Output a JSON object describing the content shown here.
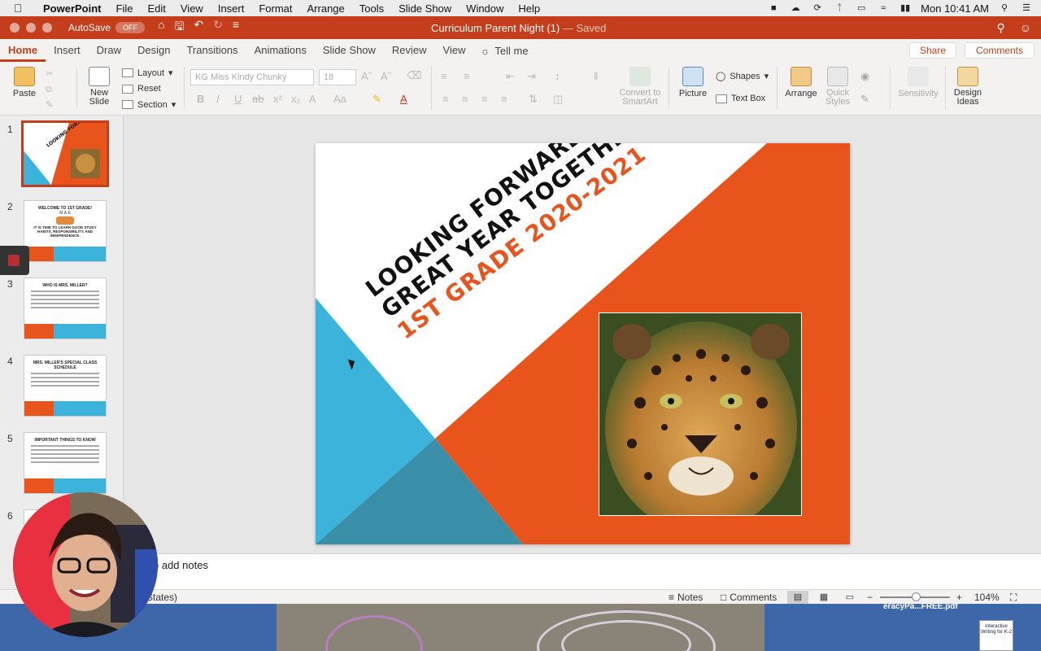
{
  "menubar": {
    "app_name": "PowerPoint",
    "items": [
      "File",
      "Edit",
      "View",
      "Insert",
      "Format",
      "Arrange",
      "Tools",
      "Slide Show",
      "Window",
      "Help"
    ],
    "clock": "Mon 10:41 AM"
  },
  "titlebar": {
    "autosave_label": "AutoSave",
    "autosave_state": "OFF",
    "doc_name": "Curriculum Parent Night (1)",
    "save_status": "— Saved"
  },
  "ribbon": {
    "tabs": [
      "Home",
      "Insert",
      "Draw",
      "Design",
      "Transitions",
      "Animations",
      "Slide Show",
      "Review",
      "View"
    ],
    "tell_me": "Tell me",
    "share": "Share",
    "comments": "Comments",
    "paste": "Paste",
    "new_slide": "New Slide",
    "layout": "Layout",
    "reset": "Reset",
    "section": "Section",
    "font_name": "KG Miss Kindy Chunky",
    "font_size": "18",
    "convert_smartart": "Convert to SmartArt",
    "picture": "Picture",
    "shapes": "Shapes",
    "text_box": "Text Box",
    "arrange": "Arrange",
    "quick_styles": "Quick Styles",
    "sensitivity": "Sensitivity",
    "design_ideas": "Design Ideas"
  },
  "thumbnails": {
    "numbers": [
      "1",
      "2",
      "3",
      "4",
      "5",
      "6"
    ],
    "slide2_title": "WELCOME TO 1ST GRADE!",
    "slide2_brand": "M.A.E",
    "slide2_body": "IT IS TIME TO LEARN GOOD STUDY HABITS, RESPONSIBILITY, AND INDEPENDENCE.",
    "slide3_title": "WHO IS MRS. MILLER?",
    "slide4_title": "MRS. MILLER'S SPECIAL CLASS SCHEDULE",
    "slide5_title": "IMPORTANT THINGS TO KNOW"
  },
  "slide": {
    "line1": "LOOKING FORWARD TO A",
    "line2": "GREAT YEAR TOGETHER!",
    "line3": "1ST GRADE 2020-2021",
    "colors": {
      "blue": "#3bb3db",
      "dark_blue": "#3a8fa8",
      "orange": "#e8541c"
    }
  },
  "notes": {
    "placeholder": "o add notes"
  },
  "statusbar": {
    "left_text": "States)",
    "notes": "Notes",
    "comments": "Comments",
    "zoom": "104%"
  },
  "desktop": {
    "file_label": "eracyPa...FREE.pdf",
    "doc_text": "Interactive Writing for K-2"
  }
}
